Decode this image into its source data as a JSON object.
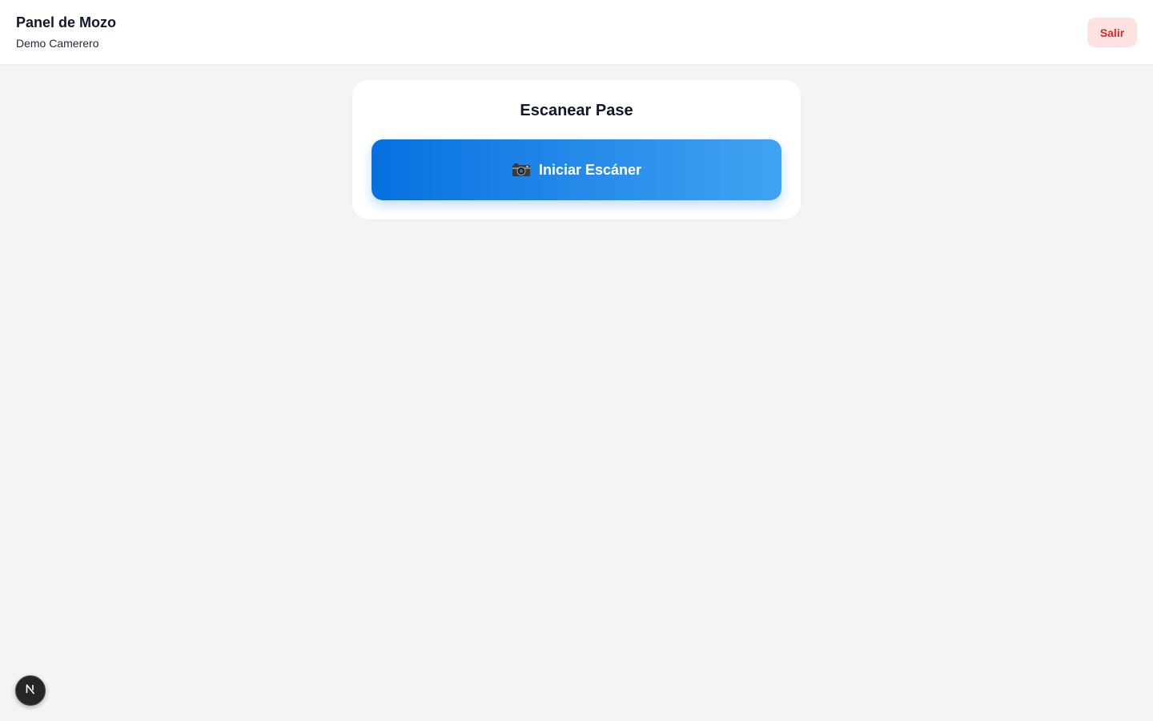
{
  "header": {
    "title": "Panel de Mozo",
    "subtitle": "Demo Camerero",
    "logout_label": "Salir"
  },
  "scan_card": {
    "title": "Escanear Pase",
    "button_icon": "camera-icon",
    "button_label": "Iniciar Escáner"
  },
  "dev_badge": {
    "icon": "nextjs-icon"
  },
  "colors": {
    "background": "#f3f4f6",
    "logout_bg": "#fee2e2",
    "logout_text": "#dc2626",
    "button_gradient_start": "#0670e0",
    "button_gradient_end": "#41a3f2"
  }
}
